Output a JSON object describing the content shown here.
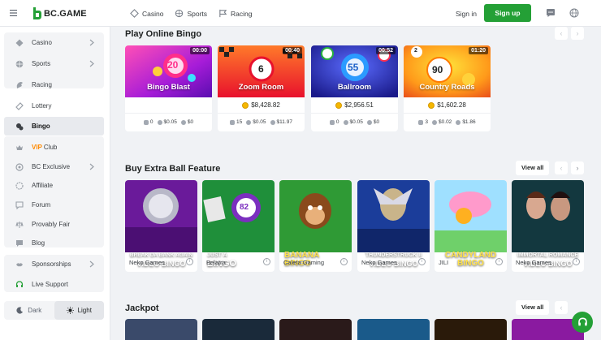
{
  "header": {
    "logo_text": "BC.GAME",
    "nav": [
      {
        "label": "Casino",
        "icon": "casino-icon"
      },
      {
        "label": "Sports",
        "icon": "sports-icon"
      },
      {
        "label": "Racing",
        "icon": "racing-icon"
      }
    ],
    "signin": "Sign in",
    "signup": "Sign up"
  },
  "sidebar": {
    "items": [
      {
        "label": "Casino",
        "icon": "casino-icon",
        "chevron": true
      },
      {
        "label": "Sports",
        "icon": "sports-icon",
        "chevron": true
      },
      {
        "label": "Racing",
        "icon": "racing-icon"
      },
      {
        "label": "Lottery",
        "icon": "lottery-icon"
      },
      {
        "label": "Bingo",
        "icon": "bingo-icon",
        "active": true
      },
      {
        "prefix": "VIP",
        "label": "Club",
        "icon": "vip-club-icon"
      },
      {
        "label": "BC Exclusive",
        "icon": "exclusive-icon",
        "chevron": true
      },
      {
        "label": "Affiliate",
        "icon": "affiliate-icon"
      },
      {
        "label": "Forum",
        "icon": "forum-icon"
      },
      {
        "label": "Provably Fair",
        "icon": "provably-fair-icon"
      },
      {
        "label": "Blog",
        "icon": "blog-icon"
      },
      {
        "label": "Sponsorships",
        "icon": "sponsorships-icon",
        "chevron": true
      },
      {
        "label": "Live Support",
        "icon": "headset-icon"
      }
    ],
    "theme": {
      "dark": "Dark",
      "light": "Light"
    }
  },
  "sections": {
    "bingo": {
      "title": "Play Online Bingo",
      "rooms": [
        {
          "name": "Bingo Blast",
          "time": "00:00",
          "jackpot": "",
          "players": "0",
          "min": "$0.05",
          "max": "$0"
        },
        {
          "name": "Zoom Room",
          "time": "00:40",
          "jackpot": "$8,428.82",
          "players": "15",
          "min": "$0.05",
          "max": "$11.97"
        },
        {
          "name": "Ballroom",
          "time": "00:52",
          "jackpot": "$2,956.51",
          "players": "0",
          "min": "$0.05",
          "max": "$0"
        },
        {
          "name": "Country Roads",
          "time": "01:20",
          "jackpot": "$1,602.28",
          "players": "3",
          "min": "$0.02",
          "max": "$1.86"
        }
      ]
    },
    "extra_ball": {
      "title": "Buy Extra Ball Feature",
      "view_all": "View all",
      "games": [
        {
          "title_line1": "BREAK DA BANK AGAIN",
          "title_line2": "VIDEO BINGO",
          "provider": "Neko Games"
        },
        {
          "title_line1": "JUST A",
          "title_line2": "BINGO",
          "provider": "Belatra"
        },
        {
          "title_line1": "BANANA",
          "title_line2": "BINGO",
          "provider": "Caleta Gaming"
        },
        {
          "title_line1": "THUNDERSTRUCK II",
          "title_line2": "VIDEO BINGO",
          "provider": "Neko Games"
        },
        {
          "title_line1": "CANDYLAND",
          "title_line2": "BINGO",
          "provider": "JILI"
        },
        {
          "title_line1": "IMMORTAL ROMANCE",
          "title_line2": "VIDEO BINGO",
          "provider": "Neko Games"
        }
      ]
    },
    "jackpot": {
      "title": "Jackpot",
      "view_all": "View all"
    }
  },
  "colors": {
    "accent": "#24a036",
    "vip": "#ff8a00",
    "coin": "#f5b700"
  }
}
